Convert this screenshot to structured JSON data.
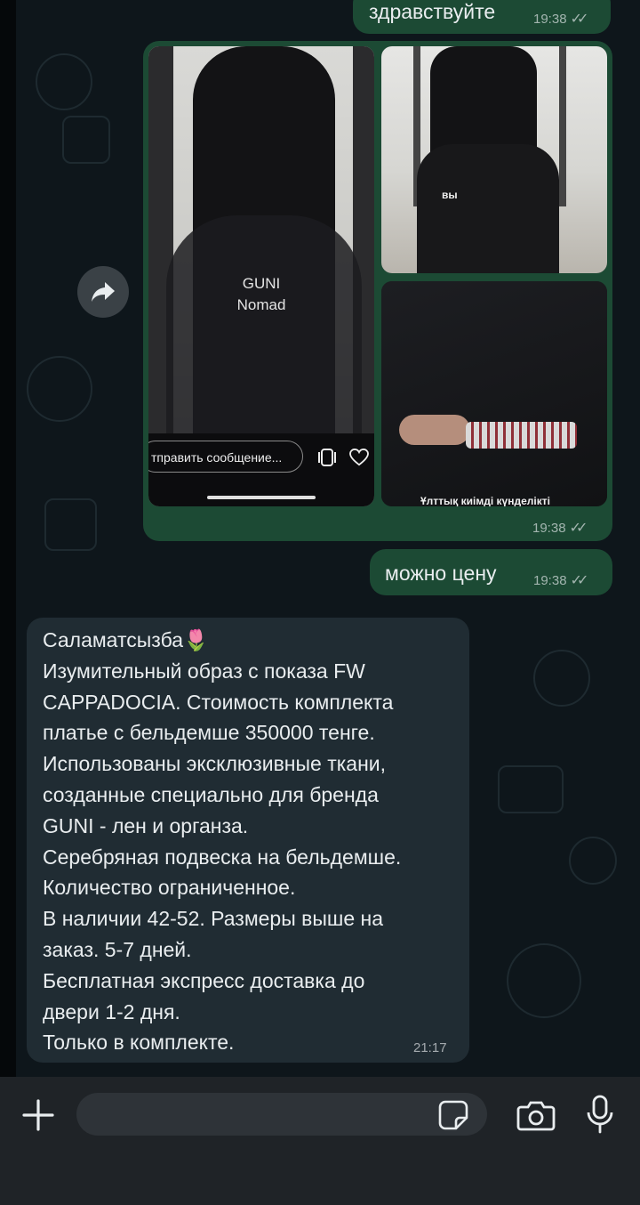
{
  "chat": {
    "messages": [
      {
        "type": "outgoing_text",
        "text": "здравствуйте",
        "time": "19:38",
        "status": "read"
      },
      {
        "type": "outgoing_media",
        "time": "19:38",
        "status": "read",
        "media": [
          {
            "overlay_title": "GUNI\nNomad",
            "title_line1": "GUNI",
            "title_line2": "Nomad",
            "input_placeholder": "тправить сообщение..."
          },
          {
            "caption": "вы"
          },
          {
            "caption": "Ұлттық киімді күнделікті"
          }
        ]
      },
      {
        "type": "outgoing_text",
        "text": "можно цену",
        "time": "19:38",
        "status": "read"
      },
      {
        "type": "incoming_text",
        "time": "21:17",
        "lines": [
          "Саламатсызба🌷",
          "Изумительный образ с показа FW",
          "CAPPADOCIA. Стоимость комплекта",
          "платье с бельдемше 350000 тенге.",
          "Использованы эксклюзивные ткани,",
          "созданные специально для бренда",
          "GUNI - лен и органза.",
          "Серебряная подвеска на бельдемше.",
          "Количество ограниченное.",
          "В наличии 42-52. Размеры выше на",
          "заказ. 5-7 дней.",
          "Бесплатная экспресс доставка до",
          "двери 1-2 дня.",
          "Только в комплекте."
        ]
      }
    ]
  },
  "composer": {
    "icons": [
      "plus-icon",
      "sticker-icon",
      "camera-icon",
      "microphone-icon"
    ]
  },
  "colors": {
    "outgoing_bubble": "#1c4a34",
    "incoming_bubble": "#202c33",
    "background": "#0e161b",
    "composer_bar": "#1f2327"
  }
}
